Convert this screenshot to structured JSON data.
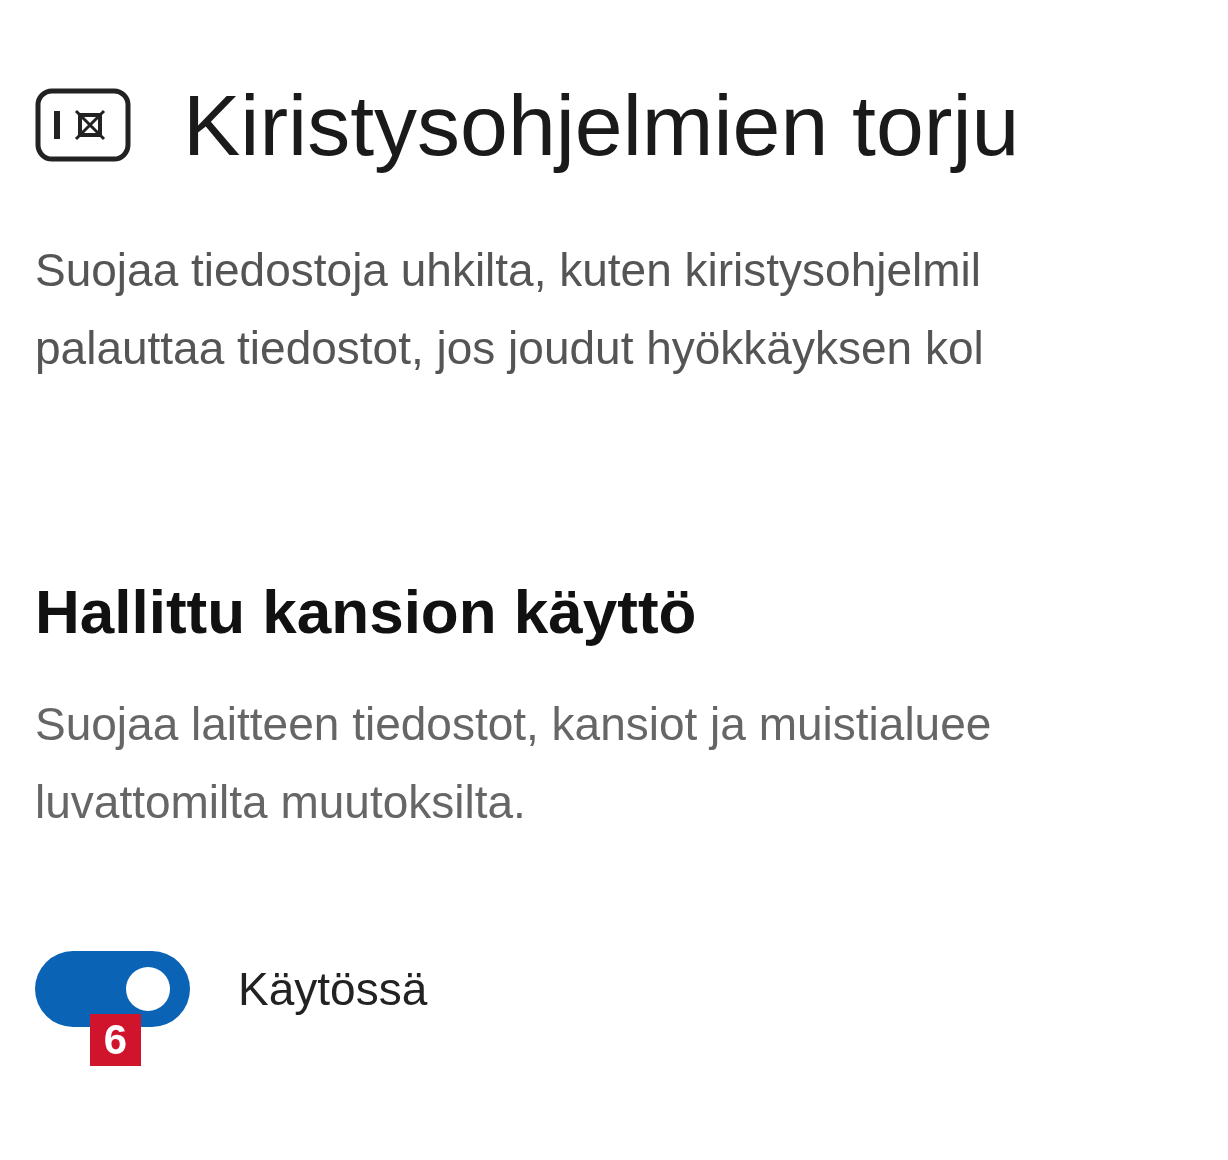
{
  "header": {
    "title": "Kiristysohjelmien torju"
  },
  "intro": "Suojaa tiedostoja uhkilta, kuten kiristysohjelmil\npalauttaa tiedostot, jos joudut hyökkäyksen kol",
  "section": {
    "heading": "Hallittu kansion käyttö",
    "description": "Suojaa laitteen tiedostot, kansiot ja muistialuee\nluvattomilta muutoksilta.",
    "toggle": {
      "on": true,
      "label": "Käytössä"
    }
  },
  "badge": "6"
}
